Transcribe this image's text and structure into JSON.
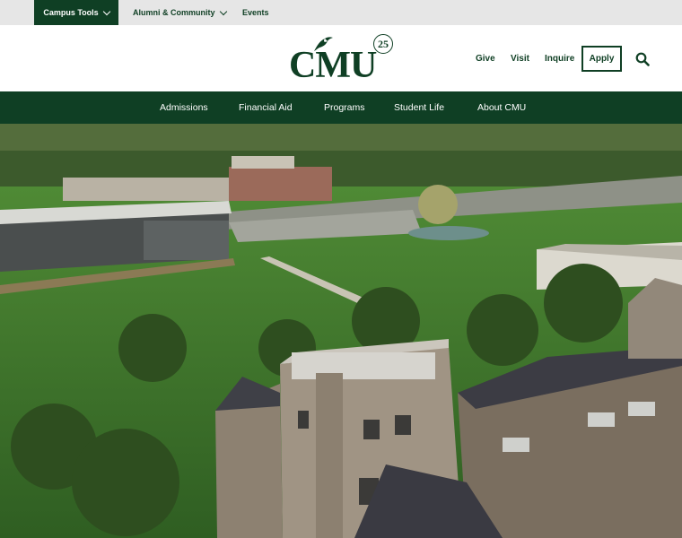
{
  "utility_nav": {
    "items": [
      {
        "label": "Campus Tools",
        "has_dropdown": true,
        "active": true
      },
      {
        "label": "Alumni & Community",
        "has_dropdown": true,
        "active": false
      },
      {
        "label": "Events",
        "has_dropdown": false,
        "active": false
      }
    ]
  },
  "header": {
    "logo_text": "CMU",
    "logo_badge": "25",
    "links": [
      "Give",
      "Visit",
      "Inquire"
    ],
    "apply_label": "Apply",
    "search_icon": "search-icon"
  },
  "main_nav": {
    "items": [
      "Admissions",
      "Financial Aid",
      "Programs",
      "Student Life",
      "About CMU"
    ]
  },
  "colors": {
    "brand_green": "#0f3f24",
    "utility_bg": "#e6e6e6"
  }
}
